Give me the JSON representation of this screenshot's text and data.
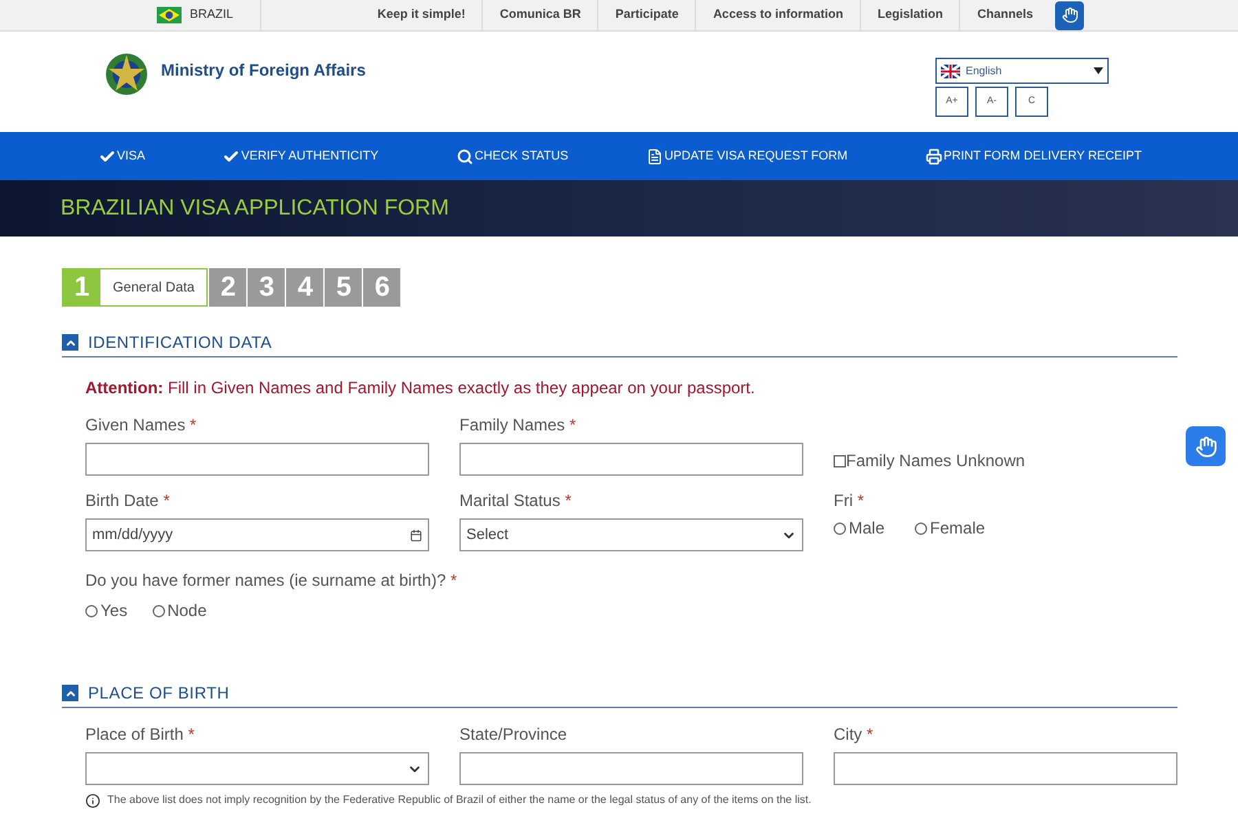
{
  "top_bar": {
    "country": "BRAZIL",
    "links": [
      "Keep it simple!",
      "Comunica BR",
      "Participate",
      "Access to information",
      "Legislation",
      "Channels"
    ]
  },
  "header": {
    "title": "Ministry of Foreign Affairs",
    "language": "English",
    "font_buttons": [
      "A+",
      "A-",
      "C"
    ]
  },
  "nav": [
    {
      "kind": "check",
      "label": "VISA"
    },
    {
      "kind": "check",
      "label": "VERIFY AUTHENTICITY"
    },
    {
      "kind": "search",
      "label": "CHECK STATUS"
    },
    {
      "kind": "document",
      "label": "UPDATE VISA REQUEST FORM"
    },
    {
      "kind": "print",
      "label": "PRINT FORM DELIVERY RECEIPT"
    }
  ],
  "banner": {
    "title": "BRAZILIAN VISA APPLICATION FORM"
  },
  "steps": [
    {
      "number": "1",
      "label": "General Data",
      "selected": true
    },
    {
      "number": "2",
      "selected": false
    },
    {
      "number": "3",
      "selected": false
    },
    {
      "number": "4",
      "selected": false
    },
    {
      "number": "5",
      "selected": false
    },
    {
      "number": "6",
      "selected": false
    }
  ],
  "identification": {
    "title": "IDENTIFICATION DATA",
    "expanded": true,
    "attention": "**Attention:** Fill in Given Names and Family Names exactly as they appear on your passport.",
    "rows": [
      [
        {
          "kind": "text",
          "label": "Given Names",
          "mark": "*"
        },
        {
          "kind": "text",
          "label": "Family Names",
          "mark": "*"
        },
        {
          "kind": "checkbox",
          "label": "Family Names Unknown",
          "checked": false
        }
      ],
      [
        {
          "kind": "date",
          "label": "Birth Date",
          "mark": "*",
          "placeholder": "mm/dd/yyyy"
        },
        {
          "kind": "select",
          "label": "Marital Status",
          "mark": "*",
          "value": "Select"
        },
        {
          "kind": "radio",
          "label": "Fri",
          "mark": "*",
          "options": [
            {
              "label": "Male",
              "selected": false
            },
            {
              "label": "Female",
              "selected": false
            }
          ]
        }
      ]
    ],
    "former_names": {
      "label": "Do you have former names (ie surname at birth)?",
      "mark": "*",
      "options": [
        {
          "label": "Yes",
          "selected": false
        },
        {
          "label": "Node",
          "selected": false
        }
      ]
    }
  },
  "place_of_birth": {
    "title": "PLACE OF BIRTH",
    "expanded": true,
    "fields": [
      {
        "kind": "select",
        "label": "Place of Birth",
        "mark": "*"
      },
      {
        "kind": "text",
        "label": "State/Province"
      },
      {
        "kind": "text",
        "label": "City",
        "mark": "*"
      }
    ],
    "note": "The above list does not imply recognition by the Federative Republic of Brazil of either the name or the legal status of any of the items on the list."
  }
}
